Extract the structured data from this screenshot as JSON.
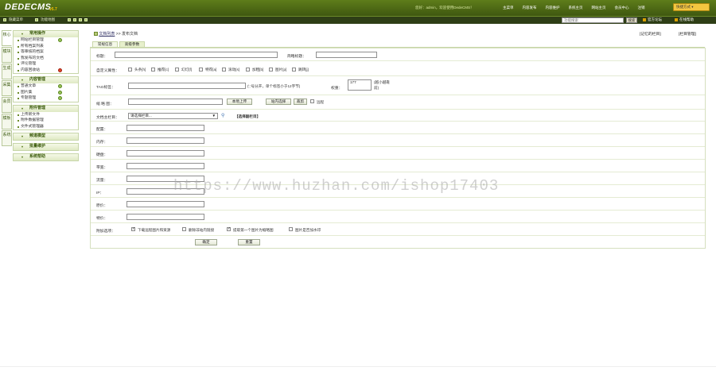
{
  "app": {
    "logo": "DEDECMS",
    "version": "v5.7",
    "top_info": "您好：admin，欢迎使用DedeCMS！",
    "top_nav": [
      "主菜单",
      "内容发布",
      "内容维护",
      "系统主页",
      "网站主页",
      "会员中心",
      "注销"
    ],
    "quick_menu": "快捷方式"
  },
  "subbar": {
    "items": [
      "隐藏菜单",
      "功能地图"
    ],
    "search_placeholder": "功能搜索",
    "search_button": "搜索",
    "links": [
      "官方论坛",
      "在线帮助"
    ]
  },
  "left_tabs": [
    "核心",
    "模块",
    "生成",
    "采集",
    "会员",
    "模板",
    "系统"
  ],
  "sidebar": {
    "groups": [
      {
        "title": "常用操作",
        "items": [
          {
            "label": "网站栏目管理",
            "icon": "add"
          },
          {
            "label": "所有档案列表",
            "icon": ""
          },
          {
            "label": "等审核的档案",
            "icon": ""
          },
          {
            "label": "我发布的文档",
            "icon": ""
          },
          {
            "label": "评论管理",
            "icon": ""
          },
          {
            "label": "内容回收站",
            "icon": "delete"
          }
        ]
      },
      {
        "title": "内容管理",
        "items": [
          {
            "label": "普通文章",
            "icon": "add"
          },
          {
            "label": "图片集",
            "icon": "add"
          },
          {
            "label": "专题管理",
            "icon": "add"
          }
        ]
      },
      {
        "title": "附件管理",
        "items": [
          {
            "label": "上传新文件",
            "icon": ""
          },
          {
            "label": "附件数据管理",
            "icon": ""
          },
          {
            "label": "文件式管理器",
            "icon": ""
          }
        ]
      },
      {
        "title": "频道模型",
        "items": []
      },
      {
        "title": "批量维护",
        "items": []
      },
      {
        "title": "系统帮助",
        "items": []
      }
    ]
  },
  "breadcrumb": {
    "link": "文档列表",
    "sep": ">>",
    "current": "发布文档"
  },
  "top_links": [
    "[记忆的栏目]",
    "[栏目管理]"
  ],
  "tabs": [
    "常规信息",
    "高级参数"
  ],
  "form": {
    "title_label": "标题：",
    "short_title_label": "简略标题：",
    "attrs_label": "自定义属性：",
    "attrs": [
      "头条[h]",
      "推荐[c]",
      "幻灯[f]",
      "特荐[a]",
      "滚动[s]",
      "加粗[b]",
      "图片[p]",
      "跳转[j]"
    ],
    "tag_label": "TAG标签：",
    "tag_hint": "(','号分开，单个标签小于12字节)",
    "weight_label": "权重：",
    "weight_value": "177",
    "weight_hint": "(越小越靠前)",
    "thumb_label": "缩 略 图：",
    "upload_btn": "本地上传",
    "site_select_btn": "站内选择",
    "crop_btn": "裁剪",
    "remote_label": "远程",
    "column_label": "文档主栏目：",
    "column_select": "请选择栏目...",
    "column_sub": "【选择副栏目】",
    "fields": [
      {
        "label": "配置："
      },
      {
        "label": "内存："
      },
      {
        "label": "硬盘："
      },
      {
        "label": "带宽："
      },
      {
        "label": "流量："
      },
      {
        "label": "IP："
      },
      {
        "label": "原价："
      },
      {
        "label": "特价："
      }
    ],
    "extra_label": "附加选项：",
    "extras": [
      {
        "label": "下载远程图片和资源",
        "checked": true
      },
      {
        "label": "删除非站内链接",
        "checked": false
      },
      {
        "label": "提取第一个图片为缩略图",
        "checked": true
      },
      {
        "label": "图片是否加水印",
        "checked": false
      }
    ],
    "ok_btn": "确定",
    "reset_btn": "重置"
  },
  "watermark": "https://www.huzhan.com/ishop17403"
}
